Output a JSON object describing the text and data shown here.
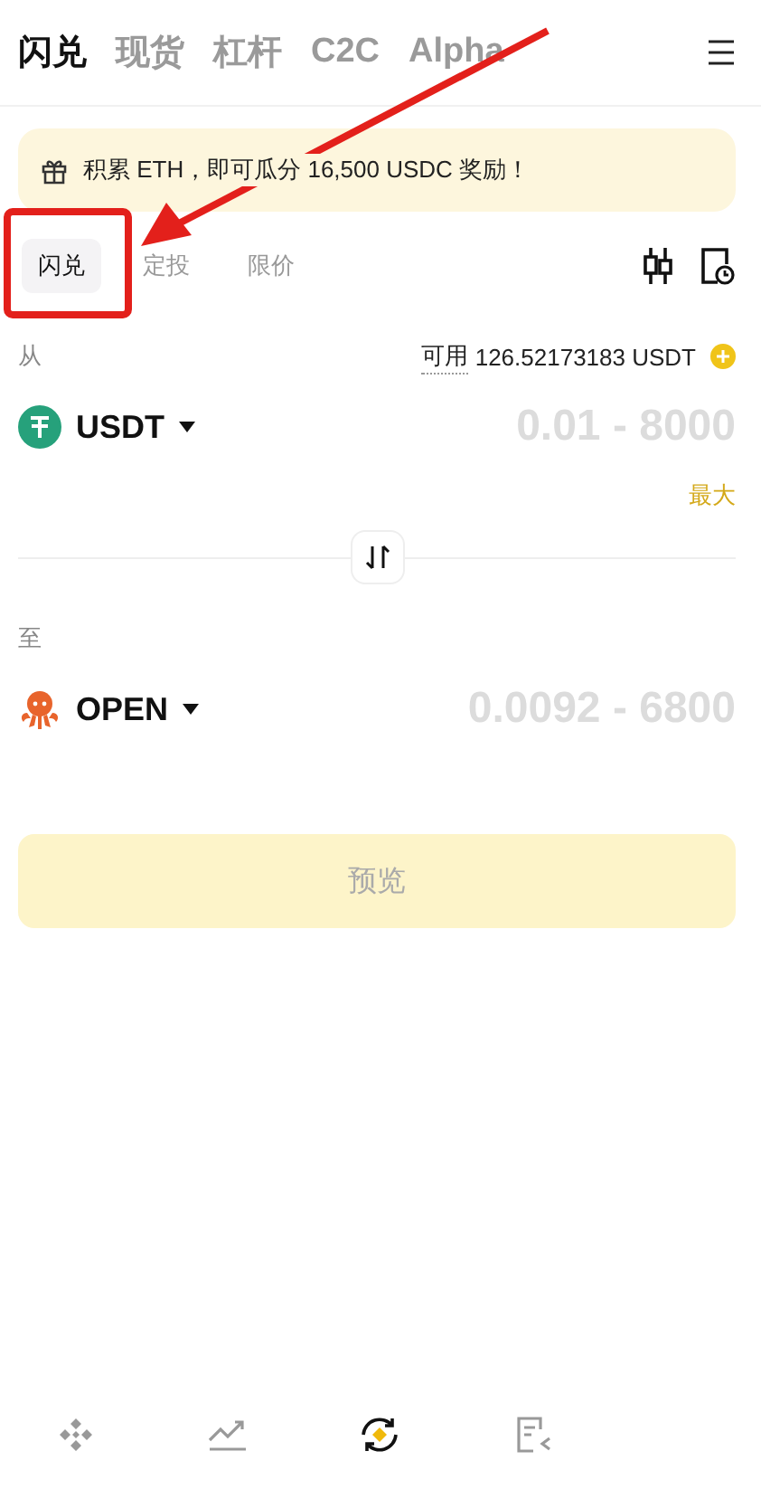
{
  "top_tabs": [
    {
      "label": "闪兑",
      "selected": true
    },
    {
      "label": "现货",
      "selected": false
    },
    {
      "label": "杠杆",
      "selected": false
    },
    {
      "label": "C2C",
      "selected": false
    },
    {
      "label": "Alpha",
      "selected": false
    }
  ],
  "banner": {
    "text": "积累 ETH，即可瓜分 16,500 USDC 奖励！"
  },
  "mode_tabs": [
    {
      "label": "闪兑",
      "selected": true
    },
    {
      "label": "定投",
      "selected": false
    },
    {
      "label": "限价",
      "selected": false
    }
  ],
  "from": {
    "label": "从",
    "available_label": "可用",
    "available": "126.52173183 USDT",
    "token": "USDT",
    "placeholder": "0.01 - 8000",
    "max": "最大"
  },
  "to": {
    "label": "至",
    "token": "OPEN",
    "placeholder": "0.0092 - 6800"
  },
  "preview_button": {
    "label": "预览",
    "disabled": true
  },
  "bottom_nav": [
    {
      "kind": "home",
      "selected": false
    },
    {
      "kind": "markets",
      "selected": false
    },
    {
      "kind": "trade",
      "selected": true
    },
    {
      "kind": "orders",
      "selected": false
    }
  ],
  "annotation": {
    "highlight_box": true,
    "arrow": true
  }
}
